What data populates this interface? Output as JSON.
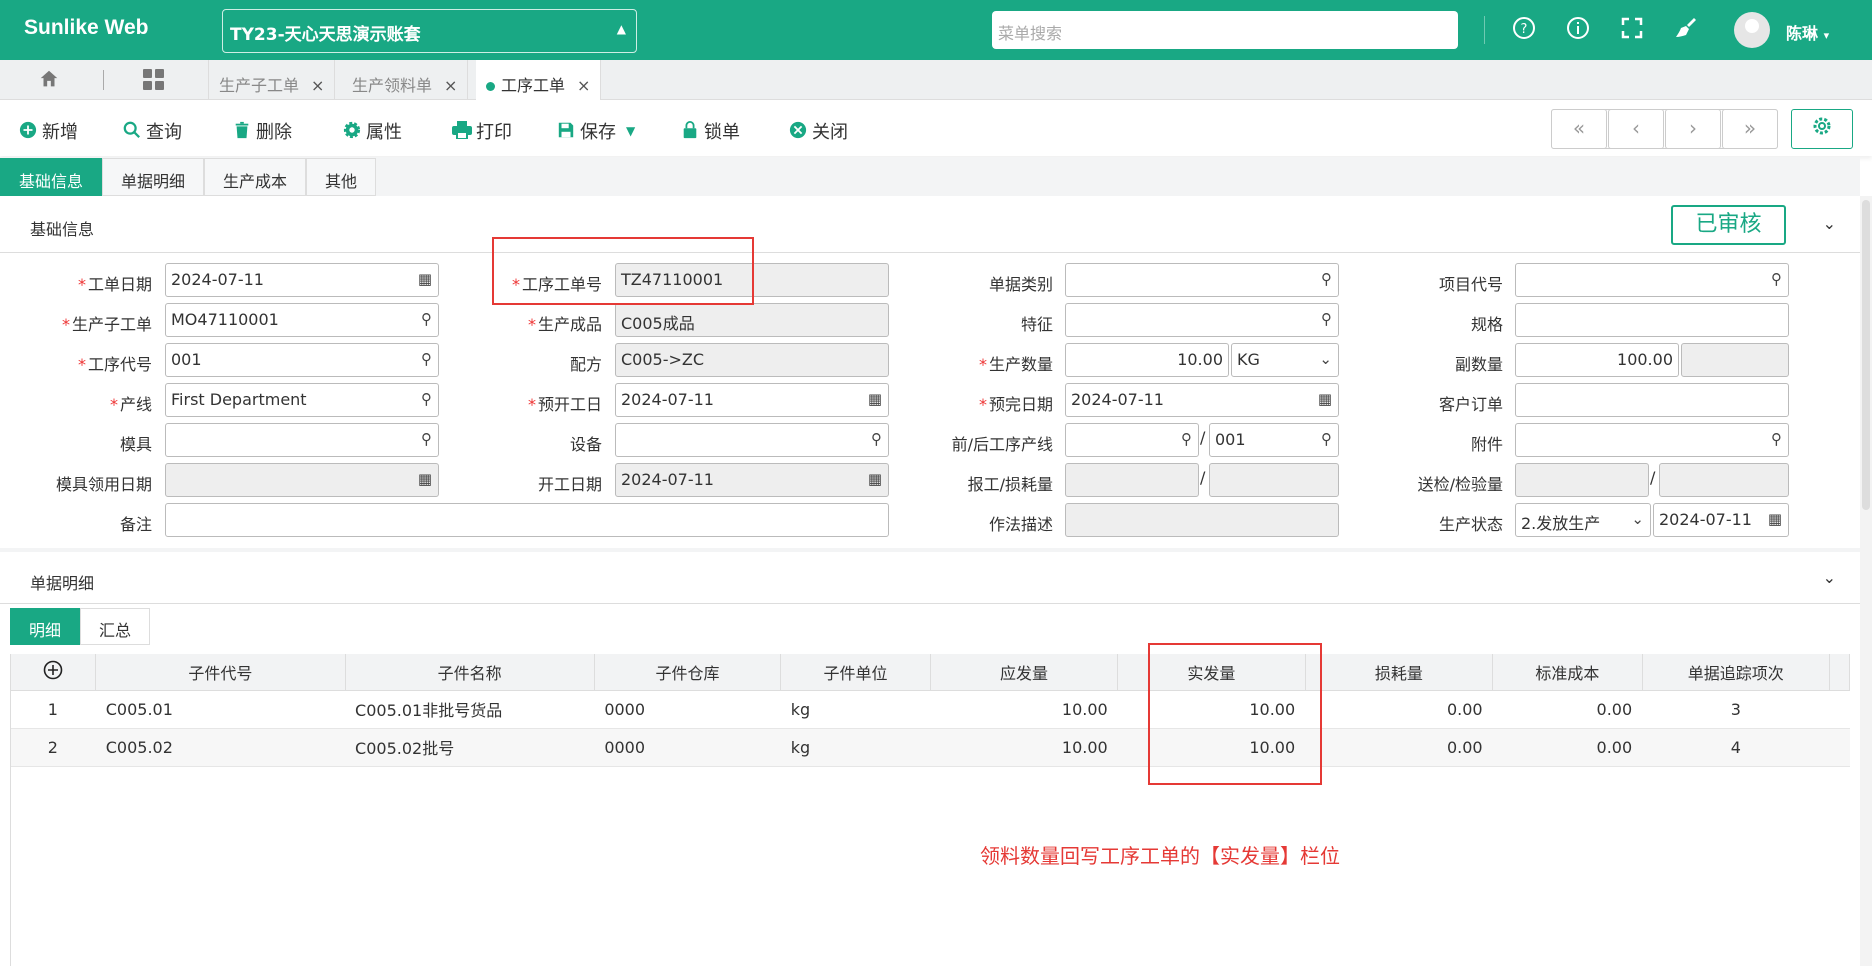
{
  "app": {
    "logo": "Sunlike Web",
    "account": "TY23-天心天思演示账套",
    "search_placeholder": "菜单搜索",
    "user": "陈琳"
  },
  "tabs": [
    {
      "label": "生产子工单",
      "close": "×"
    },
    {
      "label": "生产领料单",
      "close": "×"
    },
    {
      "label": "工序工单",
      "close": "×"
    }
  ],
  "toolbar": {
    "add": "新增",
    "query": "查询",
    "delete": "删除",
    "props": "属性",
    "print": "打印",
    "save": "保存",
    "lock": "锁单",
    "close": "关闭"
  },
  "nav": {
    "first": "«",
    "prev": "‹",
    "next": "›",
    "last": "»"
  },
  "section_tabs": [
    "基础信息",
    "单据明细",
    "生产成本",
    "其他"
  ],
  "basic": {
    "title": "基础信息",
    "status": "已审核",
    "fields": {
      "work_date_label": "工单日期",
      "work_date": "2024-07-11",
      "proc_no_label": "工序工单号",
      "proc_no": "TZ47110001",
      "doc_type_label": "单据类别",
      "doc_type": "",
      "project_label": "项目代号",
      "project": "",
      "sub_order_label": "生产子工单",
      "sub_order": "MO47110001",
      "product_label": "生产成品",
      "product": "C005成品",
      "feature_label": "特征",
      "feature": "",
      "spec_label": "规格",
      "spec": "",
      "proc_code_label": "工序代号",
      "proc_code": "001",
      "formula_label": "配方",
      "formula": "C005->ZC",
      "qty_label": "生产数量",
      "qty": "10.00",
      "unit": "KG",
      "sub_qty_label": "副数量",
      "sub_qty": "100.00",
      "line_label": "产线",
      "line": "First Department",
      "plan_start_label": "预开工日",
      "plan_start": "2024-07-11",
      "plan_end_label": "预完日期",
      "plan_end": "2024-07-11",
      "cust_order_label": "客户订单",
      "cust_order": "",
      "mold_label": "模具",
      "mold": "",
      "equip_label": "设备",
      "equip": "",
      "prev_next_label": "前/后工序产线",
      "next_line": "001",
      "attach_label": "附件",
      "attach": "",
      "mold_date_label": "模具领用日期",
      "mold_date": "",
      "start_date_label": "开工日期",
      "start_date": "2024-07-11",
      "report_label": "报工/损耗量",
      "inspect_label": "送检/检验量",
      "remark_label": "备注",
      "remark": "",
      "method_label": "作法描述",
      "method": "",
      "prod_status_label": "生产状态",
      "prod_status": "2.发放生产",
      "prod_status_date": "2024-07-11"
    }
  },
  "detail": {
    "title": "单据明细",
    "subtabs": [
      "明细",
      "汇总"
    ],
    "columns": [
      "子件代号",
      "子件名称",
      "子件仓库",
      "子件单位",
      "应发量",
      "实发量",
      "损耗量",
      "标准成本",
      "单据追踪项次"
    ],
    "rows": [
      {
        "no": "1",
        "code": "C005.01",
        "name": "C005.01非批号货品",
        "wh": "0000",
        "unit": "kg",
        "should": "10.00",
        "actual": "10.00",
        "loss": "0.00",
        "cost": "0.00",
        "trace": "3"
      },
      {
        "no": "2",
        "code": "C005.02",
        "name": "C005.02批号",
        "wh": "0000",
        "unit": "kg",
        "should": "10.00",
        "actual": "10.00",
        "loss": "0.00",
        "cost": "0.00",
        "trace": "4"
      }
    ]
  },
  "annotation": "领料数量回写工序工单的【实发量】栏位"
}
